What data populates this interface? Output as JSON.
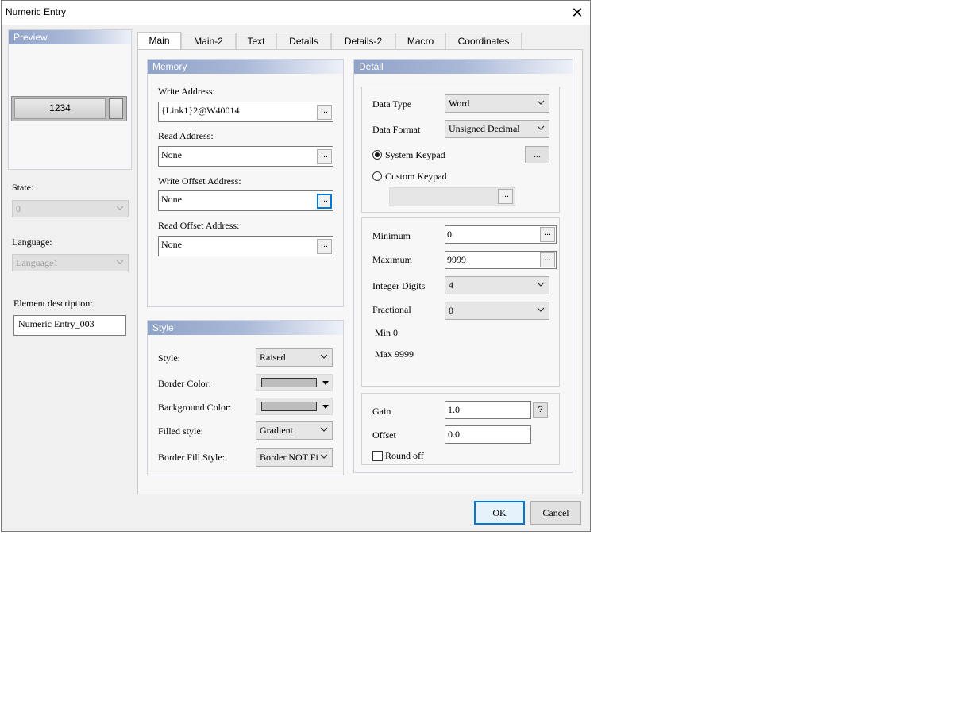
{
  "window": {
    "title": "Numeric Entry",
    "close_label": "✕"
  },
  "preview": {
    "header": "Preview",
    "value": "1234"
  },
  "left": {
    "state_label": "State:",
    "state_value": "0",
    "language_label": "Language:",
    "language_value": "Language1",
    "description_label": "Element description:",
    "description_value": "Numeric Entry_003"
  },
  "tabs": [
    "Main",
    "Main-2",
    "Text",
    "Details",
    "Details-2",
    "Macro",
    "Coordinates"
  ],
  "memory": {
    "header": "Memory",
    "write_address_label": "Write Address:",
    "write_address_value": "{Link1}2@W40014",
    "read_address_label": "Read Address:",
    "read_address_value": "None",
    "write_offset_label": "Write Offset Address:",
    "write_offset_value": "None",
    "read_offset_label": "Read Offset Address:",
    "read_offset_value": "None",
    "browse_label": "..."
  },
  "style": {
    "header": "Style",
    "style_label": "Style:",
    "style_value": "Raised",
    "border_color_label": "Border Color:",
    "background_color_label": "Background Color:",
    "filled_style_label": "Filled style:",
    "filled_style_value": "Gradient",
    "border_fill_label": "Border Fill Style:",
    "border_fill_value": "Border NOT Fi",
    "border_color": "#bdbdbd",
    "background_color": "#bdbdbd"
  },
  "detail": {
    "header": "Detail",
    "data_type_label": "Data Type",
    "data_type_value": "Word",
    "data_format_label": "Data Format",
    "data_format_value": "Unsigned Decimal",
    "system_keypad_label": "System Keypad",
    "custom_keypad_label": "Custom Keypad",
    "keypad_selected": "system",
    "minimum_label": "Minimum",
    "minimum_value": "0",
    "maximum_label": "Maximum",
    "maximum_value": "9999",
    "integer_digits_label": "Integer Digits",
    "integer_digits_value": "4",
    "fractional_label": "Fractional",
    "fractional_value": "0",
    "min_text": "Min 0",
    "max_text": "Max 9999",
    "gain_label": "Gain",
    "gain_value": "1.0",
    "help_label": "?",
    "offset_label": "Offset",
    "offset_value": "0.0",
    "round_off_label": "Round off",
    "round_off_checked": false
  },
  "buttons": {
    "ok": "OK",
    "cancel": "Cancel"
  }
}
